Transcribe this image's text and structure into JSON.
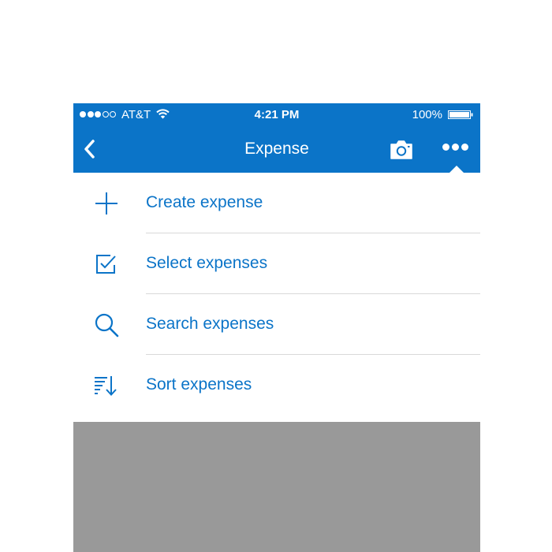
{
  "colors": {
    "accent": "#0b74c8",
    "overlay": "#999999",
    "menu_background": "#ffffff"
  },
  "status_bar": {
    "carrier": "AT&T",
    "time": "4:21 PM",
    "battery": "100%",
    "signal_bars_filled": 3,
    "signal_bars_total": 5
  },
  "nav": {
    "title": "Expense",
    "back_icon": "chevron-left-icon",
    "camera_icon": "camera-icon",
    "more_icon": "more-dots-icon"
  },
  "menu": {
    "items": [
      {
        "label": "Create expense",
        "icon": "plus-icon"
      },
      {
        "label": "Select expenses",
        "icon": "checkbox-icon"
      },
      {
        "label": "Search expenses",
        "icon": "search-icon"
      },
      {
        "label": "Sort expenses",
        "icon": "sort-icon"
      }
    ]
  }
}
